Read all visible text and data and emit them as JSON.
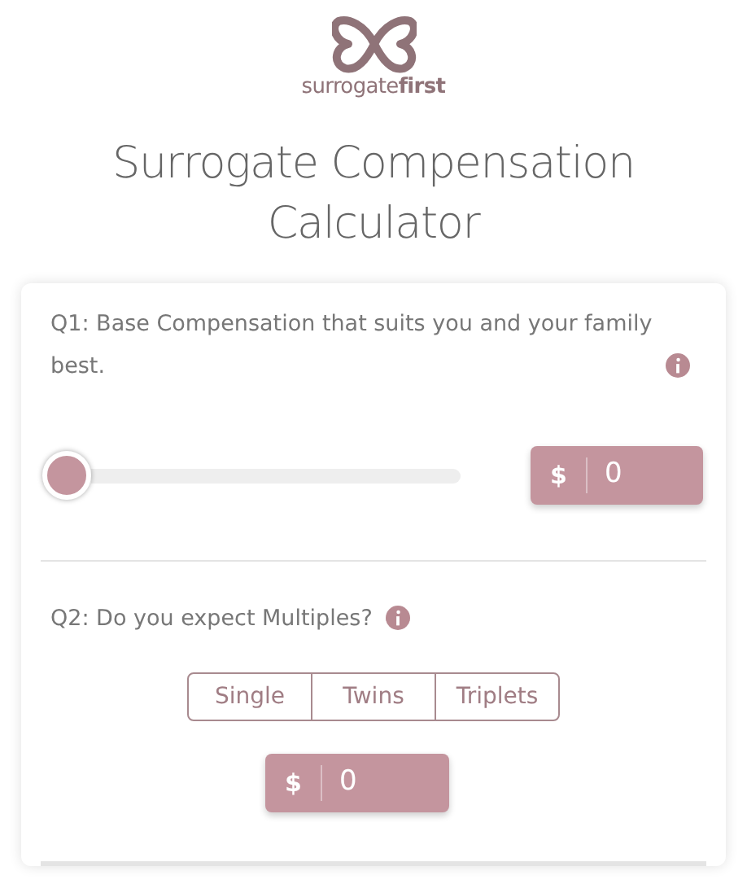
{
  "logo": {
    "text": "surrogate**first**"
  },
  "title": "Surrogate Compensation Calculator",
  "questions": [
    {
      "kind": "slider",
      "label": "Q1: Base Compensation that suits you and your family best.",
      "level": 0,
      "currency": "$",
      "amount": "0"
    },
    {
      "kind": "choice",
      "label": "Q2: Do you expect Multiples?",
      "options": [
        {
          "label": "Single",
          "selected": false
        },
        {
          "label": "Twins",
          "selected": false
        },
        {
          "label": "Triplets",
          "selected": false
        }
      ],
      "currency": "$",
      "amount": "0"
    }
  ]
}
